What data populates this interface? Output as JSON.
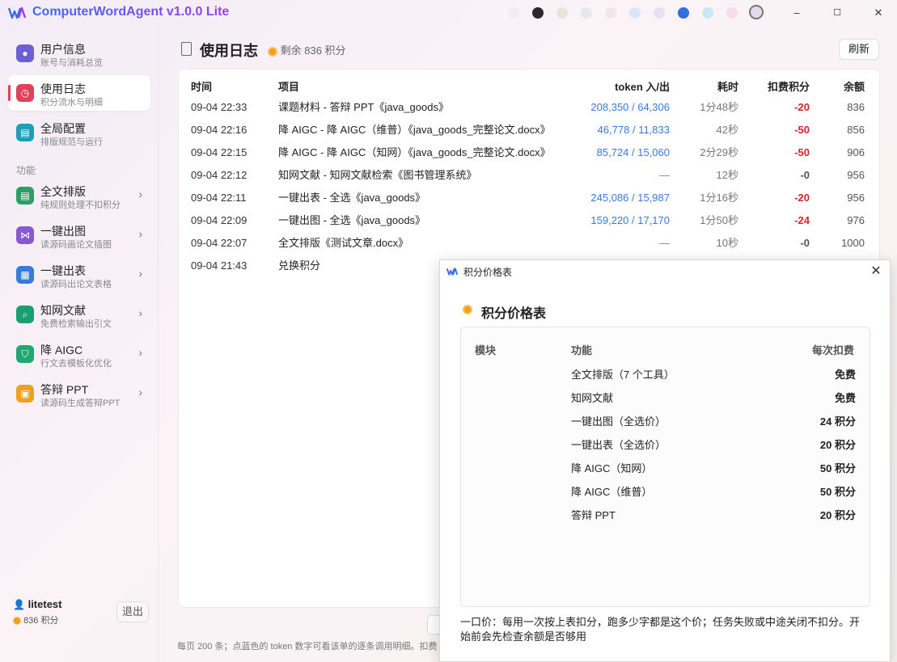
{
  "app": {
    "title": "ComputerWordAgent v1.0.0 Lite"
  },
  "theme_swatches": [
    "#f0eef0",
    "#2a2a2a",
    "#e8e4d8",
    "#e6e8f0",
    "#f3e6e8",
    "#dde6f6",
    "#e8e0f4",
    "#2f6fe0",
    "#cde6f6",
    "#f6dde8",
    "#e8d8ee"
  ],
  "window_controls": {
    "minimize": "–",
    "maximize": "☐",
    "close": "✕"
  },
  "sidebar": {
    "items": [
      {
        "label": "用户信息",
        "sub": "账号与消耗总览",
        "icon": "user-icon",
        "color": "#6b5ed6"
      },
      {
        "label": "使用日志",
        "sub": "积分流水与明细",
        "icon": "clock-icon",
        "color": "#e0405a"
      },
      {
        "label": "全局配置",
        "sub": "排版规范与运行",
        "icon": "doc-icon",
        "color": "#1ba0b8"
      }
    ],
    "section_label": "功能",
    "features": [
      {
        "label": "全文排版",
        "sub": "纯规则处理不扣积分",
        "icon": "doc-icon",
        "color": "#2aa068"
      },
      {
        "label": "一键出图",
        "sub": "读源码画论文插图",
        "icon": "share-icon",
        "color": "#8a58d0"
      },
      {
        "label": "一键出表",
        "sub": "读源码出论文表格",
        "icon": "table-icon",
        "color": "#3a7bd5"
      },
      {
        "label": "知网文献",
        "sub": "免费检索输出引文",
        "icon": "book-search-icon",
        "color": "#1aa070"
      },
      {
        "label": "降 AIGC",
        "sub": "行文去模板化优化",
        "icon": "shield-icon",
        "color": "#20a870"
      },
      {
        "label": "答辩 PPT",
        "sub": "读源码生成答辩PPT",
        "icon": "presentation-icon",
        "color": "#f0a020"
      }
    ],
    "user": {
      "name": "litetest",
      "credits": "836 积分"
    },
    "logout_label": "退出"
  },
  "main": {
    "title": "使用日志",
    "remaining": "剩余 836 积分",
    "refresh_label": "刷新",
    "columns": [
      "时间",
      "项目",
      "token 入/出",
      "耗时",
      "扣费积分",
      "余额"
    ],
    "rows": [
      {
        "time": "09-04 22:33",
        "item": "课题材料 - 答辩 PPT《java_goods》",
        "token": "208,350 / 64,306",
        "duration": "1分48秒",
        "cost": "-20",
        "balance": "836"
      },
      {
        "time": "09-04 22:16",
        "item": "降 AIGC - 降 AIGC（维普）《java_goods_完整论文.docx》",
        "token": "46,778 / 11,833",
        "duration": "42秒",
        "cost": "-50",
        "balance": "856"
      },
      {
        "time": "09-04 22:15",
        "item": "降 AIGC - 降 AIGC（知网）《java_goods_完整论文.docx》",
        "token": "85,724 / 15,060",
        "duration": "2分29秒",
        "cost": "-50",
        "balance": "906"
      },
      {
        "time": "09-04 22:12",
        "item": "知网文献 - 知网文献检索《图书管理系统》",
        "token": "—",
        "duration": "12秒",
        "cost": "-0",
        "balance": "956"
      },
      {
        "time": "09-04 22:11",
        "item": "一键出表 - 全选《java_goods》",
        "token": "245,086 / 15,987",
        "duration": "1分16秒",
        "cost": "-20",
        "balance": "956"
      },
      {
        "time": "09-04 22:09",
        "item": "一键出图 - 全选《java_goods》",
        "token": "159,220 / 17,170",
        "duration": "1分50秒",
        "cost": "-24",
        "balance": "976"
      },
      {
        "time": "09-04 22:07",
        "item": "全文排版《测试文章.docx》",
        "token": "—",
        "duration": "10秒",
        "cost": "-0",
        "balance": "1000"
      },
      {
        "time": "09-04 21:43",
        "item": "兑换积分",
        "token": "",
        "duration": "",
        "cost": "",
        "balance": ""
      }
    ],
    "footer_note": "每页 200 条；点蓝色的 token 数字可看该单的逐条调用明细。扣费"
  },
  "dialog": {
    "window_title": "积分价格表",
    "heading": "积分价格表",
    "columns": [
      "模块",
      "功能",
      "每次扣费"
    ],
    "rows": [
      {
        "name": "全文排版（7 个工具）",
        "price": "免费"
      },
      {
        "name": "知网文献",
        "price": "免费"
      },
      {
        "name": "一键出图（全选价）",
        "price": "24 积分"
      },
      {
        "name": "一键出表（全选价）",
        "price": "20 积分"
      },
      {
        "name": "降 AIGC（知网）",
        "price": "50 积分"
      },
      {
        "name": "降 AIGC（维普）",
        "price": "50 积分"
      },
      {
        "name": "答辩 PPT",
        "price": "20 积分"
      }
    ],
    "note": "一口价：每用一次按上表扣分，跑多少字都是这个价；任务失败或中途关闭不扣分。开始前会先检查余额是否够用",
    "close": "✕"
  }
}
